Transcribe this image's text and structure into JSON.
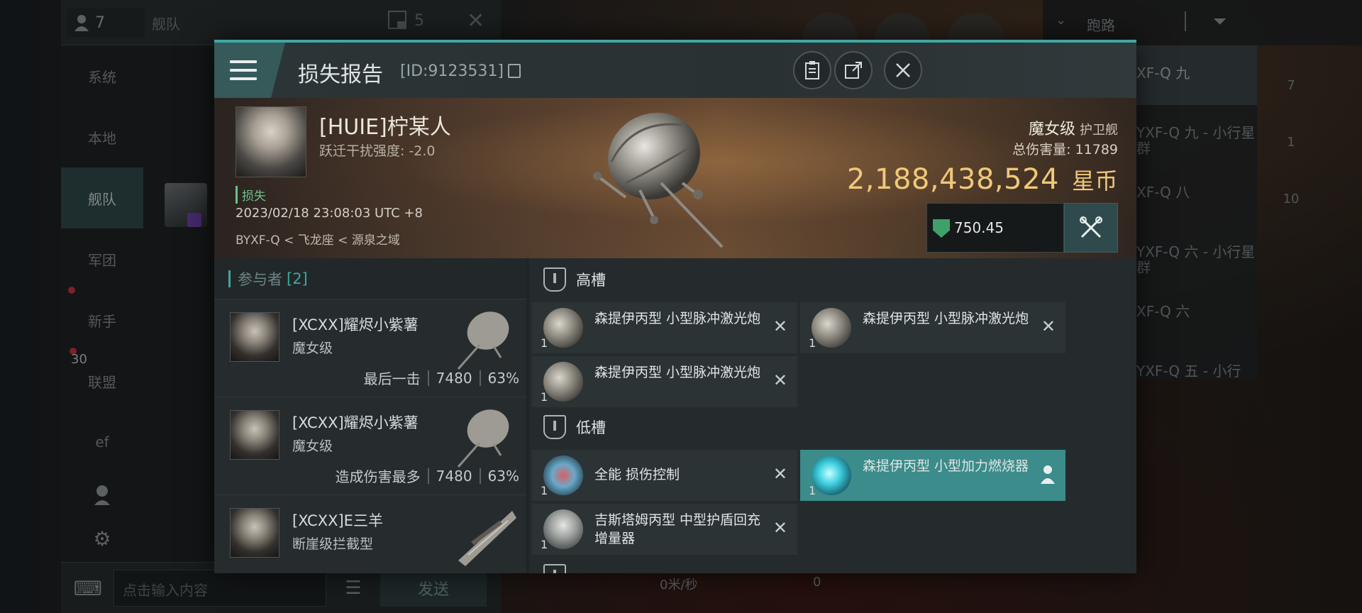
{
  "background": {
    "fleet_panel": {
      "member_count": "7",
      "title": "舰队",
      "squad_count": "5"
    },
    "side_menu": [
      "系统",
      "本地",
      "舰队",
      "军团",
      "新手",
      "联盟",
      "ef"
    ],
    "badge_count": "30",
    "chat": {
      "placeholder": "点击输入内容",
      "send_label": "发送"
    },
    "route": {
      "label": "跑路",
      "systems": [
        "XF-Q 九",
        "YXF-Q 九 - 小行星群",
        "XF-Q 八",
        "YXF-Q 六 - 小行星群",
        "XF-Q 六",
        "YXF-Q 五 - 小行"
      ]
    },
    "right_counts": [
      "7",
      "1",
      "10"
    ],
    "status": {
      "speed": "0米/秒",
      "value": "0"
    }
  },
  "modal": {
    "title": "损失报告",
    "report_id": "[ID:9123531]",
    "victim": {
      "name": "[HUIE]柠某人",
      "disruption": "跃迁干扰强度: -2.0",
      "loss_label": "损失",
      "timestamp": "2023/02/18 23:08:03 UTC +8",
      "location": "BYXF-Q < 飞龙座 < 源泉之域"
    },
    "ship": {
      "class": "魔女级",
      "category": "护卫舰",
      "total_damage_label": "总伤害量: 11789",
      "isk_value": "2,188,438,524",
      "isk_unit": "星币",
      "fitting_value": "750.45"
    },
    "participants": {
      "label": "参与者",
      "count": "[2]",
      "rows": [
        {
          "name": "[XCXX]耀烬小紫薯",
          "ship": "魔女级",
          "tag": "最后一击",
          "damage": "7480",
          "percent": "63%"
        },
        {
          "name": "[XCXX]耀烬小紫薯",
          "ship": "魔女级",
          "tag": "造成伤害最多",
          "damage": "7480",
          "percent": "63%"
        },
        {
          "name": "[XCXX]E三羊",
          "ship": "断崖级拦截型",
          "tag": "",
          "damage": "",
          "percent": ""
        }
      ]
    },
    "slots": {
      "high": {
        "label": "高槽",
        "modules": [
          {
            "name": "森提伊丙型 小型脉冲激光炮",
            "qty": "1"
          },
          {
            "name": "森提伊丙型 小型脉冲激光炮",
            "qty": "1"
          },
          {
            "name": "森提伊丙型 小型脉冲激光炮",
            "qty": "1"
          }
        ]
      },
      "low": {
        "label": "低槽",
        "modules": [
          {
            "name": "全能 损伤控制",
            "qty": "1"
          },
          {
            "name": "森提伊丙型 小型加力燃烧器",
            "qty": "1"
          },
          {
            "name": "吉斯塔姆丙型 中型护盾回充增量器",
            "qty": "1"
          }
        ]
      }
    }
  },
  "colors": {
    "accent": "#3fa7a2",
    "isk": "#f0c879",
    "loss": "#6fbf8a"
  }
}
